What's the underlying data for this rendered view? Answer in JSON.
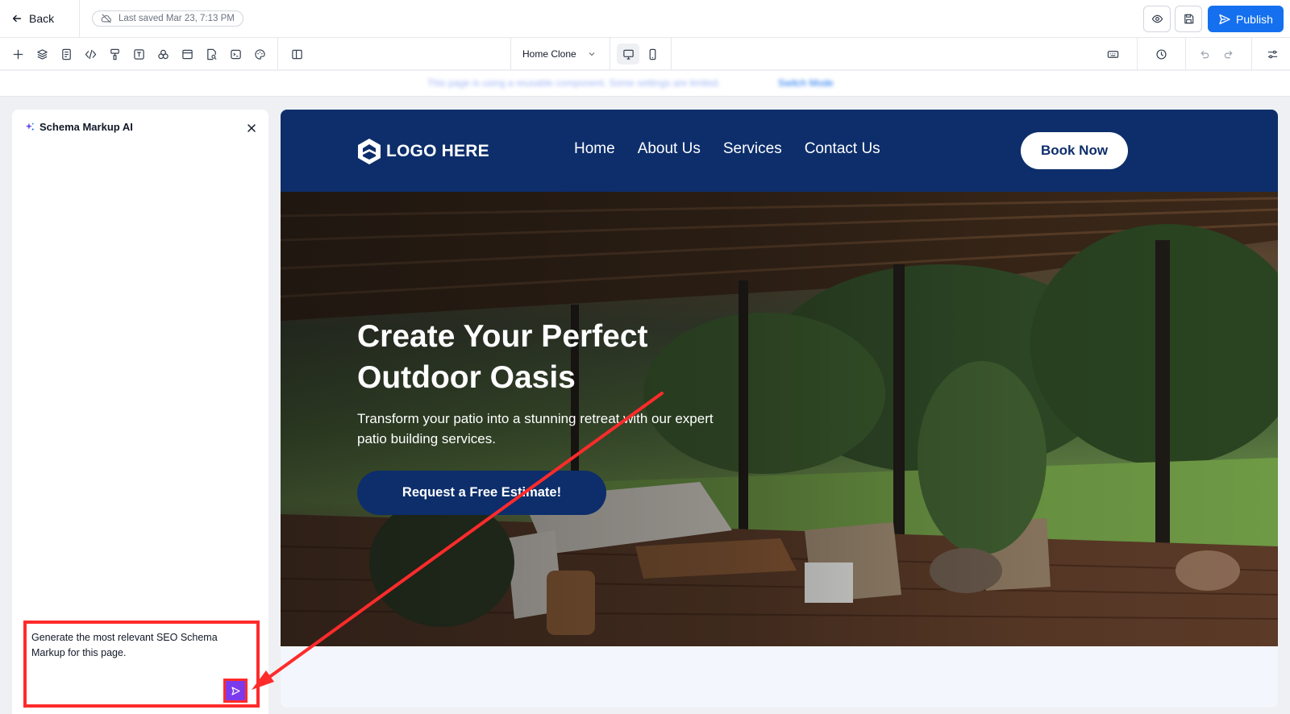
{
  "topbar": {
    "back_label": "Back",
    "saved_status": "Last saved Mar 23, 7:13 PM",
    "publish_label": "Publish"
  },
  "toolbar": {
    "page_name": "Home Clone",
    "tools": [
      "plus-icon",
      "layers-icon",
      "page-icon",
      "code-icon",
      "paint-roller-icon",
      "text-icon",
      "shapes-icon",
      "window-icon",
      "search-page-icon",
      "terminal-icon",
      "palette-icon"
    ]
  },
  "notice": {
    "text": "This page is using a reusable component. Some settings are limited.",
    "link": "Switch Mode"
  },
  "panel": {
    "title": "Schema Markup AI",
    "prompt": "Generate the most relevant SEO Schema Markup for this page."
  },
  "site": {
    "logo_text": "LOGO HERE",
    "nav": [
      "Home",
      "About Us",
      "Services",
      "Contact Us"
    ],
    "book_label": "Book Now",
    "hero_title": "Create Your Perfect Outdoor Oasis",
    "hero_subtitle": "Transform your patio into a stunning retreat with our expert patio building services.",
    "cta_label": "Request a Free Estimate!"
  },
  "colors": {
    "accent_blue": "#1570ef",
    "site_navy": "#0d2e6b",
    "annotation_red": "#ff2b2b",
    "send_purple": "#7c3aed"
  }
}
